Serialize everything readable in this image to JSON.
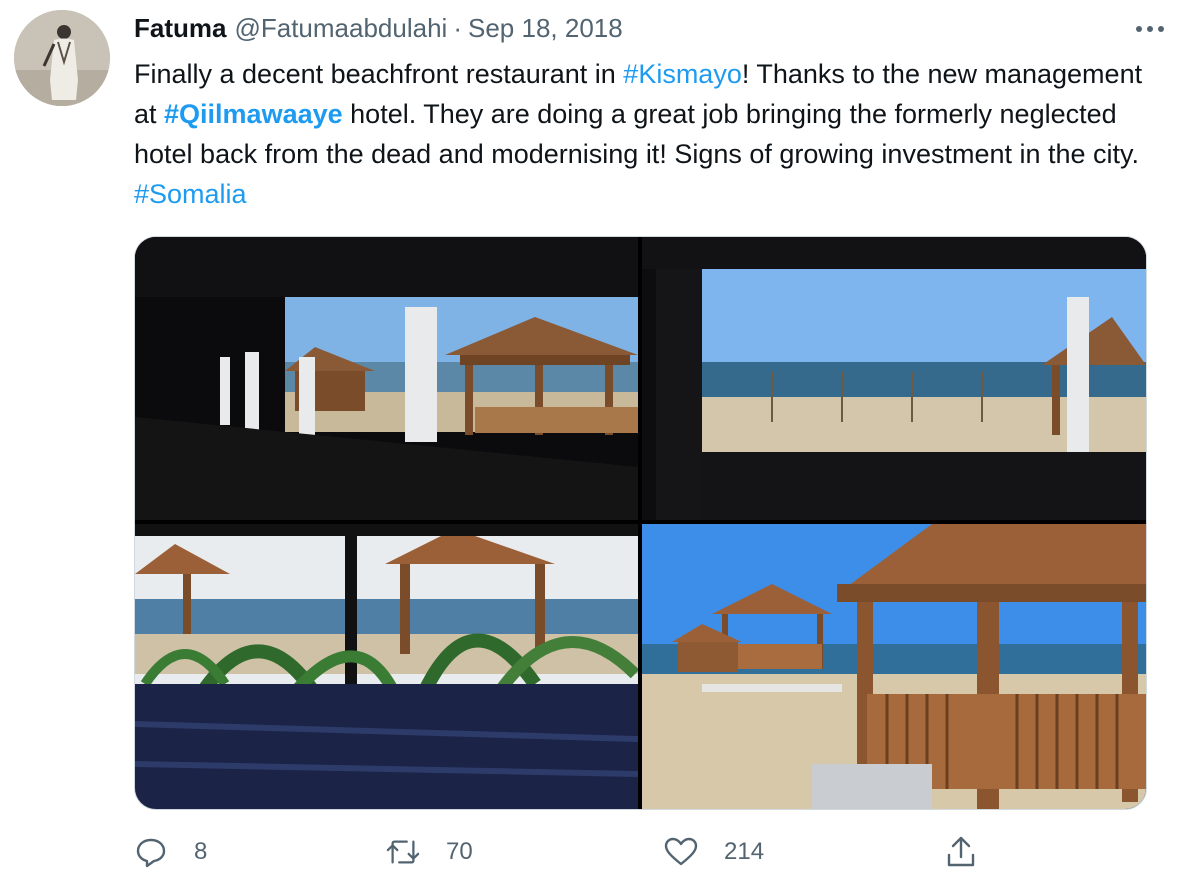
{
  "tweet": {
    "author": {
      "name": "Fatuma",
      "handle": "@Fatumaabdulahi",
      "separator": "·",
      "date": "Sep 18, 2018"
    },
    "text": {
      "t1": "Finally a decent beachfront restaurant in ",
      "tag_kismayo": "#Kismayo",
      "t2": "! Thanks to the new management at ",
      "tag_qiilmawaaye": "#Qiilmawaaye",
      "t3": " hotel. They are doing a great job bringing the formerly neglected hotel back from the dead and modernising it! Signs of growing investment in the city. ",
      "tag_somalia": "#Somalia"
    },
    "actions": {
      "replies": "8",
      "retweets": "70",
      "likes": "214"
    }
  },
  "icons": {
    "more": "more-icon",
    "reply": "reply-icon",
    "retweet": "retweet-icon",
    "like": "heart-icon",
    "share": "share-icon"
  },
  "colors": {
    "accent": "#1d9bf0",
    "text": "#0f1419",
    "secondary": "#536471",
    "border": "#cfd9de"
  }
}
